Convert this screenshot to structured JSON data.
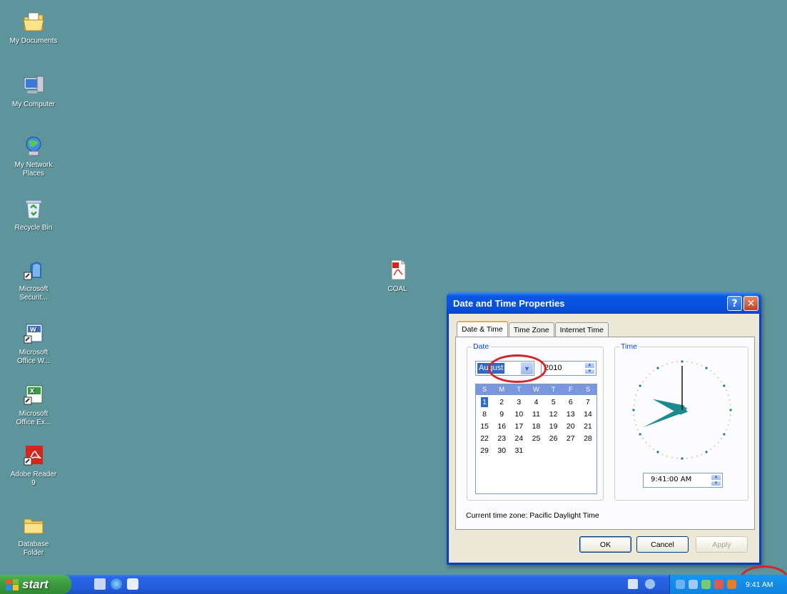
{
  "desktop": {
    "icons": [
      {
        "label": "My Documents",
        "icon": "my-documents-icon"
      },
      {
        "label": "My Computer",
        "icon": "my-computer-icon"
      },
      {
        "label": "My Network\nPlaces",
        "icon": "network-places-icon"
      },
      {
        "label": "Recycle Bin",
        "icon": "recycle-bin-icon"
      },
      {
        "label": "Microsoft\nSecurit...",
        "icon": "security-essentials-icon"
      },
      {
        "label": "Microsoft\nOffice W...",
        "icon": "word-icon"
      },
      {
        "label": "Microsoft\nOffice Ex...",
        "icon": "excel-icon"
      },
      {
        "label": "Adobe Reader\n9",
        "icon": "adobe-reader-icon"
      },
      {
        "label": "Database\nFolder",
        "icon": "folder-icon"
      },
      {
        "label": "COAL",
        "icon": "pdf-file-icon"
      }
    ]
  },
  "dialog": {
    "title": "Date and Time Properties",
    "help_btn": "?",
    "close_btn": "✕",
    "tabs": [
      "Date & Time",
      "Time Zone",
      "Internet Time"
    ],
    "date_group_label": "Date",
    "time_group_label": "Time",
    "month_value": "August",
    "year_value": "2010",
    "calendar": {
      "weekdays": [
        "S",
        "M",
        "T",
        "W",
        "T",
        "F",
        "S"
      ],
      "days": [
        "1",
        "2",
        "3",
        "4",
        "5",
        "6",
        "7",
        "8",
        "9",
        "10",
        "11",
        "12",
        "13",
        "14",
        "15",
        "16",
        "17",
        "18",
        "19",
        "20",
        "21",
        "22",
        "23",
        "24",
        "25",
        "26",
        "27",
        "28",
        "29",
        "30",
        "31"
      ],
      "selected_day": "1"
    },
    "time_value": "9:41:00 AM",
    "clock": {
      "hour": 9,
      "minute": 41,
      "second": 0
    },
    "timezone_text": "Current time zone:  Pacific Daylight Time",
    "buttons": {
      "ok": "OK",
      "cancel": "Cancel",
      "apply": "Apply"
    }
  },
  "taskbar": {
    "start_label": "start",
    "clock": "9:41 AM"
  },
  "colors": {
    "desktop": "#5e949c",
    "titlebar": "#0752e0",
    "annotation": "#d1252b"
  }
}
